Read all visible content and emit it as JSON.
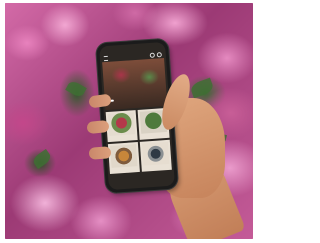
{
  "phone": {
    "status_time": "",
    "brand_name": "",
    "hero_title": "",
    "hero_button_label": "",
    "tiles": [
      {
        "caption": ""
      },
      {
        "caption": ""
      },
      {
        "caption": ""
      },
      {
        "caption": ""
      }
    ]
  },
  "colors": {
    "flowers_primary": "#c5478e",
    "flowers_light": "#f0a8d3",
    "leaves": "#3f6e34",
    "skin": "#d69a72",
    "phone_body": "#1b1b1b",
    "screen_bg": "#2b2723"
  },
  "icons": [
    "menu-icon",
    "search-icon",
    "cart-icon"
  ]
}
